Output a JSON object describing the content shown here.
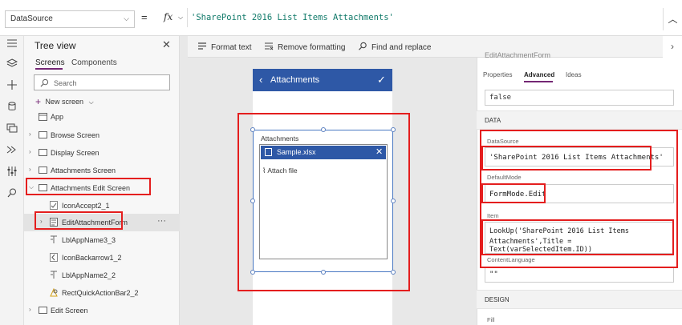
{
  "formula_bar": {
    "property": "DataSource",
    "equals": "=",
    "fx": "fx",
    "formula": "'SharePoint 2016 List Items Attachments'"
  },
  "toolbar": {
    "format_text": "Format text",
    "remove_formatting": "Remove formatting",
    "find_replace": "Find and replace"
  },
  "tree": {
    "title": "Tree view",
    "tab_screens": "Screens",
    "tab_components": "Components",
    "search_placeholder": "Search",
    "new_screen": "New screen",
    "items": [
      {
        "label": "App"
      },
      {
        "label": "Browse Screen"
      },
      {
        "label": "Display Screen"
      },
      {
        "label": "Attachments Screen"
      },
      {
        "label": "Attachments Edit Screen"
      },
      {
        "label": "IconAccept2_1"
      },
      {
        "label": "EditAttachmentForm"
      },
      {
        "label": "LblAppName3_3"
      },
      {
        "label": "IconBackarrow1_2"
      },
      {
        "label": "LblAppName2_2"
      },
      {
        "label": "RectQuickActionBar2_2"
      },
      {
        "label": "Edit Screen"
      }
    ],
    "more": "···"
  },
  "canvas": {
    "header_title": "Attachments",
    "attachments_label": "Attachments",
    "file_name": "Sample.xlsx",
    "attach_file": "Attach file"
  },
  "properties": {
    "control_name": "EditAttachmentForm",
    "tabs": [
      "Properties",
      "Advanced",
      "Ideas"
    ],
    "top_value": "false",
    "section_data": "DATA",
    "datasource_label": "DataSource",
    "datasource_value": "'SharePoint 2016 List Items Attachments'",
    "defaultmode_label": "DefaultMode",
    "defaultmode_value": "FormMode.Edit",
    "item_label": "Item",
    "item_value_line1": "LookUp('SharePoint 2016 List Items",
    "item_value_line2": "Attachments',Title = Text(varSelectedItem.ID))",
    "contentlanguage_label": "ContentLanguage",
    "contentlanguage_value": "\"\"",
    "section_design": "DESIGN",
    "fill_label": "Fill"
  },
  "colors": {
    "accent_purple": "#742774",
    "app_blue": "#2e58a6",
    "highlight_red": "#e41e1e",
    "formula_teal": "#117a6a"
  }
}
